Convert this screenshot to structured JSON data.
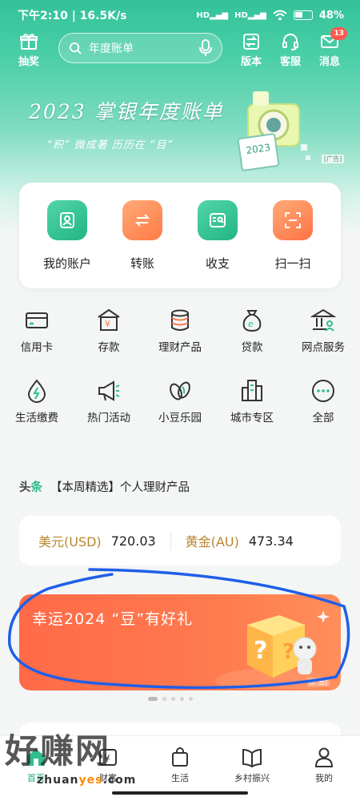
{
  "status_bar": {
    "time_speed": "下午2:10 | 16.5K/s",
    "battery": "48%"
  },
  "header": {
    "lottery_label": "抽奖",
    "search_placeholder": "年度账单",
    "version_label": "版本",
    "service_label": "客服",
    "messages_label": "消息",
    "messages_badge": "13"
  },
  "banner": {
    "title": "2023 掌银年度账单",
    "subtitle": "“积” 微成著 历历在 “目”",
    "ad_tag": "[广告]",
    "calendar_digits": "2023"
  },
  "quick_actions": [
    {
      "label": "我的账户",
      "icon": "user-icon",
      "color": "#2fbf8f"
    },
    {
      "label": "转账",
      "icon": "transfer-icon",
      "color": "#ff8c4f"
    },
    {
      "label": "收支",
      "icon": "ledger-search-icon",
      "color": "#2fbf8f"
    },
    {
      "label": "扫一扫",
      "icon": "scan-icon",
      "color": "#ff7a52"
    }
  ],
  "services_row1": [
    {
      "label": "信用卡",
      "icon": "credit-card-icon"
    },
    {
      "label": "存款",
      "icon": "deposit-icon"
    },
    {
      "label": "理财产品",
      "icon": "wealth-coins-icon"
    },
    {
      "label": "贷款",
      "icon": "loan-bag-icon"
    },
    {
      "label": "网点服务",
      "icon": "branch-bank-icon"
    }
  ],
  "services_row2": [
    {
      "label": "生活缴费",
      "icon": "utility-drop-icon"
    },
    {
      "label": "热门活动",
      "icon": "megaphone-icon"
    },
    {
      "label": "小豆乐园",
      "icon": "beans-icon"
    },
    {
      "label": "城市专区",
      "icon": "city-buildings-icon"
    },
    {
      "label": "全部",
      "icon": "more-dots-icon"
    }
  ],
  "headline": {
    "tag_a": "头",
    "tag_b": "条",
    "text": "【本周精选】个人理财产品"
  },
  "rates": {
    "usd_label": "美元(USD)",
    "usd_value": "720.03",
    "gold_label": "黄金(AU)",
    "gold_value": "473.34"
  },
  "promo": {
    "text": "幸运2024 “豆”有好礼",
    "ad_tag": "[广告]"
  },
  "tabbar": [
    {
      "label": "首页",
      "icon": "home-icon"
    },
    {
      "label": "财富",
      "icon": "wealth-icon"
    },
    {
      "label": "生活",
      "icon": "shopping-bag-icon"
    },
    {
      "label": "乡村振兴",
      "icon": "book-leaf-icon"
    },
    {
      "label": "我的",
      "icon": "profile-icon"
    }
  ],
  "watermark": {
    "text": "好赚网",
    "url_a": "zhuan",
    "url_b": "yes",
    "url_c": ".com"
  },
  "colors": {
    "brand_green": "#2fbf8f",
    "accent_orange": "#ff7a52",
    "gold_text": "#b8862f",
    "badge_red": "#ff5a4e"
  }
}
